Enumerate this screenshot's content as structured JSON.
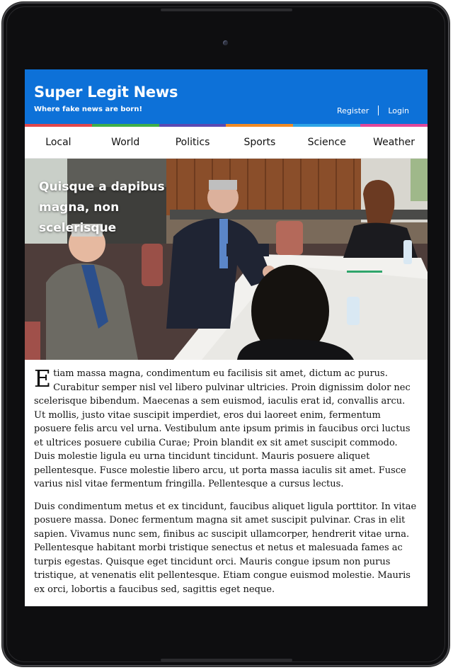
{
  "site": {
    "title": "Super Legit News",
    "tagline": "Where fake news are born!",
    "register_label": "Register",
    "login_label": "Login",
    "header_color": "#0d71d8",
    "strip_colors": [
      "#e0474c",
      "#3fae49",
      "#5a4ab3",
      "#f08a24",
      "#2ea5e6",
      "#e0479a"
    ]
  },
  "nav": {
    "items": [
      "Local",
      "World",
      "Politics",
      "Sports",
      "Science",
      "Weather"
    ]
  },
  "hero": {
    "headline": "Quisque a dapibus magna, non scelerisque"
  },
  "article": {
    "dropcap": "E",
    "paragraph1_rest": "tiam massa magna, condimentum eu facilisis sit amet, dictum ac purus. Curabitur semper nisl vel libero pulvinar ultricies. Proin dignissim dolor nec scelerisque bibendum. Maecenas a sem euismod, iaculis erat id, convallis arcu. Ut mollis, justo vitae suscipit imperdiet, eros dui laoreet enim, fermentum posuere felis arcu vel urna. Vestibulum ante ipsum primis in faucibus orci luctus et ultrices posuere cubilia Curae; Proin blandit ex sit amet suscipit commodo. Duis molestie ligula eu urna tincidunt tincidunt. Mauris posuere aliquet pellentesque. Fusce molestie libero arcu, ut porta massa iaculis sit amet. Fusce varius nisl vitae fermentum fringilla. Pellentesque a cursus lectus.",
    "paragraph2": "Duis condimentum metus et ex tincidunt, faucibus aliquet ligula porttitor. In vitae posuere massa. Donec fermentum magna sit amet suscipit pulvinar. Cras in elit sapien. Vivamus nunc sem, finibus ac suscipit ullamcorper, hendrerit vitae urna. Pellentesque habitant morbi tristique senectus et netus et malesuada fames ac turpis egestas. Quisque eget tincidunt orci. Mauris congue ipsum non purus tristique, at venenatis elit pellentesque. Etiam congue euismod molestie. Mauris ex orci, lobortis a faucibus sed, sagittis eget neque."
  }
}
